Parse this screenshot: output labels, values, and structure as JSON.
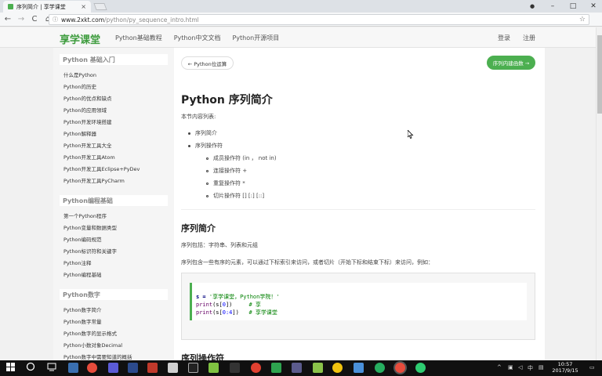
{
  "browser": {
    "tab_title": "序列简介 | 享学课堂",
    "tab_close": "×",
    "url_host": "www.2xkt.com",
    "url_path": "/python/py_sequence_intro.html",
    "back": "←",
    "forward": "→",
    "reload": "C",
    "home": "⌂",
    "page_icon": "ⓘ",
    "star": "☆",
    "menu": "⋮",
    "account": "●",
    "minimize": "–",
    "maximize": "□",
    "close": "✕"
  },
  "site": {
    "logo": "享学课堂",
    "nav": [
      "Python基础教程",
      "Python中文文档",
      "Python开源项目"
    ],
    "login": "登录",
    "register": "注册"
  },
  "sidebar": {
    "sections": [
      {
        "title": "Python 基础入门",
        "items": [
          "什么是Python",
          "Python的历史",
          "Python的优点和缺点",
          "Python的应用领域",
          "Python开发环境搭建",
          "Python解释器",
          "Python开发工具大全",
          "Python开发工具Atom",
          "Python开发工具Eclipse+PyDev",
          "Python开发工具PyCharm"
        ]
      },
      {
        "title": "Python编程基础",
        "items": [
          "第一个Python程序",
          "Python变量和数据类型",
          "Python编码规范",
          "Python标识符和关键字",
          "Python注释",
          "Python编程基础"
        ]
      },
      {
        "title": "Python数字",
        "items": [
          "Python数字简介",
          "Python数字常量",
          "Python数字的显示格式",
          "Python小数对象Decimal",
          "Python数字中需要知道的概括"
        ]
      }
    ]
  },
  "main": {
    "prev_label": "← Python位运算",
    "next_label": "序列内建函数 →",
    "title": "Python 序列简介",
    "toc_intro": "本节内容列表:",
    "toc": [
      "序列简介",
      "序列操作符"
    ],
    "toc_sub": [
      "成员操作符 (in ， not in)",
      "连接操作符 +",
      "重复操作符 *",
      "切片操作符 [] [:] [::]"
    ],
    "section1_title": "序列简介",
    "section1_p1": "序列包括：字符串、列表和元组",
    "section1_p2": "序列包含一些有序的元素，可以通过下标索引来访问，或者切片（开始下标和结束下标）来访问，例如：",
    "code": {
      "line1_var": "s = ",
      "line1_str": "'享学课堂，Python学院！'",
      "line2_fn": "print",
      "line2_rest": "(s[",
      "line2_num": "0",
      "line2_end": "])     ",
      "line2_cmt": "# 享",
      "line3_fn": "print",
      "line3_rest": "(s[",
      "line3_num": "0:4",
      "line3_end": "])   ",
      "line3_cmt": "# 享学课堂"
    },
    "section2_title": "序列操作符"
  },
  "taskbar": {
    "time": "10:57",
    "date": "2017/9/15",
    "ime": "中",
    "tray_up": "^",
    "notify": "▭"
  },
  "colors": {
    "brand": "#3e9c3e",
    "button": "#4caf50"
  }
}
